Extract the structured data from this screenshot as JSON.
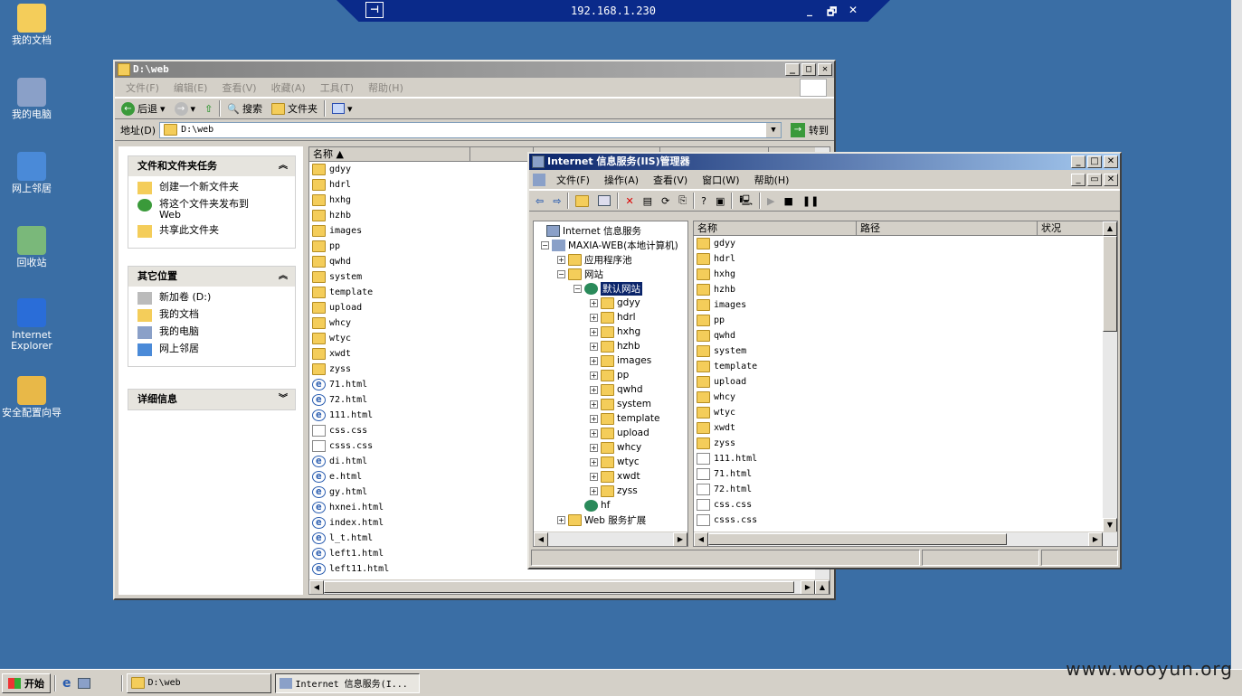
{
  "desktop": {
    "icons": [
      "我的文档",
      "我的电脑",
      "网上邻居",
      "回收站",
      "Internet Explorer",
      "安全配置向导"
    ]
  },
  "remote": {
    "ip": "192.168.1.230",
    "minimize": "_",
    "restore": "🗗",
    "close": "✕"
  },
  "explorer": {
    "title": "D:\\web",
    "menu": [
      "文件(F)",
      "编辑(E)",
      "查看(V)",
      "收藏(A)",
      "工具(T)",
      "帮助(H)"
    ],
    "toolbar": {
      "back": "后退",
      "search": "搜索",
      "folders": "文件夹"
    },
    "address": {
      "label": "地址(D)",
      "value": "D:\\web",
      "go": "转到"
    },
    "tasks": {
      "title": "文件和文件夹任务",
      "items": [
        "创建一个新文件夹",
        "将这个文件夹发布到\nWeb",
        "共享此文件夹"
      ]
    },
    "places": {
      "title": "其它位置",
      "items": [
        "新加卷 (D:)",
        "我的文档",
        "我的电脑",
        "网上邻居"
      ]
    },
    "details": {
      "title": "详细信息"
    },
    "col_name": "名称",
    "files": [
      {
        "n": "gdyy",
        "t": "d"
      },
      {
        "n": "hdrl",
        "t": "d"
      },
      {
        "n": "hxhg",
        "t": "d"
      },
      {
        "n": "hzhb",
        "t": "d"
      },
      {
        "n": "images",
        "t": "d"
      },
      {
        "n": "pp",
        "t": "d"
      },
      {
        "n": "qwhd",
        "t": "d"
      },
      {
        "n": "system",
        "t": "d"
      },
      {
        "n": "template",
        "t": "d"
      },
      {
        "n": "upload",
        "t": "d"
      },
      {
        "n": "whcy",
        "t": "d"
      },
      {
        "n": "wtyc",
        "t": "d"
      },
      {
        "n": "xwdt",
        "t": "d"
      },
      {
        "n": "zyss",
        "t": "d"
      },
      {
        "n": "71.html",
        "t": "h"
      },
      {
        "n": "72.html",
        "t": "h"
      },
      {
        "n": "111.html",
        "t": "h"
      },
      {
        "n": "css.css",
        "t": "c"
      },
      {
        "n": "csss.css",
        "t": "c"
      },
      {
        "n": "di.html",
        "t": "h"
      },
      {
        "n": "e.html",
        "t": "h"
      },
      {
        "n": "gy.html",
        "t": "h"
      },
      {
        "n": "hxnei.html",
        "t": "h"
      },
      {
        "n": "index.html",
        "t": "h"
      },
      {
        "n": "l_t.html",
        "t": "h"
      },
      {
        "n": "left1.html",
        "t": "h"
      },
      {
        "n": "left11.html",
        "t": "h"
      }
    ]
  },
  "iis": {
    "title": "Internet 信息服务(IIS)管理器",
    "menu": [
      "文件(F)",
      "操作(A)",
      "查看(V)",
      "窗口(W)",
      "帮助(H)"
    ],
    "tree": {
      "root": "Internet 信息服务",
      "machine": "MAXIA-WEB(本地计算机)",
      "pools": "应用程序池",
      "sites": "网站",
      "default_site": "默认网站",
      "children": [
        "gdyy",
        "hdrl",
        "hxhg",
        "hzhb",
        "images",
        "pp",
        "qwhd",
        "system",
        "template",
        "upload",
        "whcy",
        "wtyc",
        "xwdt",
        "zyss"
      ],
      "hf": "hf",
      "ext": "Web 服务扩展"
    },
    "cols": [
      "名称",
      "路径",
      "状况"
    ],
    "list": [
      {
        "n": "gdyy",
        "t": "d"
      },
      {
        "n": "hdrl",
        "t": "d"
      },
      {
        "n": "hxhg",
        "t": "d"
      },
      {
        "n": "hzhb",
        "t": "d"
      },
      {
        "n": "images",
        "t": "d"
      },
      {
        "n": "pp",
        "t": "d"
      },
      {
        "n": "qwhd",
        "t": "d"
      },
      {
        "n": "system",
        "t": "d"
      },
      {
        "n": "template",
        "t": "d"
      },
      {
        "n": "upload",
        "t": "d"
      },
      {
        "n": "whcy",
        "t": "d"
      },
      {
        "n": "wtyc",
        "t": "d"
      },
      {
        "n": "xwdt",
        "t": "d"
      },
      {
        "n": "zyss",
        "t": "d"
      },
      {
        "n": "111.html",
        "t": "f"
      },
      {
        "n": "71.html",
        "t": "f"
      },
      {
        "n": "72.html",
        "t": "f"
      },
      {
        "n": "css.css",
        "t": "f"
      },
      {
        "n": "csss.css",
        "t": "f"
      }
    ]
  },
  "taskbar": {
    "start": "开始",
    "tasks": [
      "D:\\web",
      "Internet 信息服务(I..."
    ]
  },
  "watermark": "www.wooyun.org"
}
